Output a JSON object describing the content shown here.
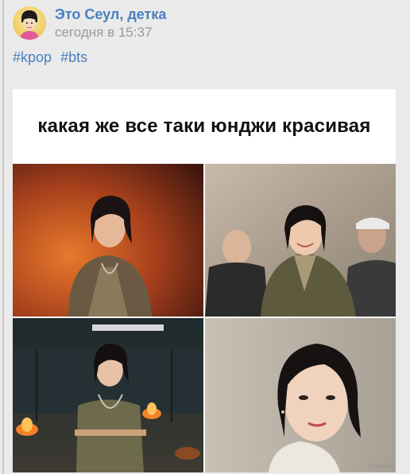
{
  "post": {
    "author": "Это Сеул, детка",
    "timestamp": "сегодня в 15:37",
    "tags": [
      "#kpop",
      "#bts"
    ]
  },
  "image": {
    "caption": "какая же все таки юнджи красивая",
    "watermark": "lyricsby",
    "photos": [
      {
        "name": "photo-fire-background"
      },
      {
        "name": "photo-street-smile"
      },
      {
        "name": "photo-night-torches"
      },
      {
        "name": "photo-closeup-portrait"
      }
    ]
  },
  "colors": {
    "link": "#4a7fbf",
    "muted": "#9a9a9a",
    "background": "#eaeaea"
  }
}
